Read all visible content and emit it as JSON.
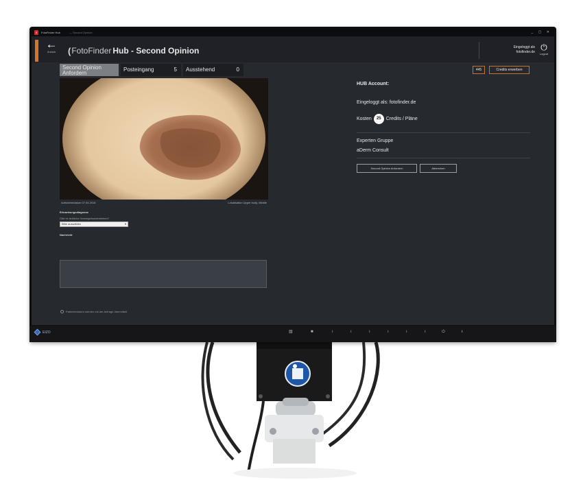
{
  "os_bar": {
    "app_title": "FotoFinder Hub",
    "subtitle": "— Second Opinion",
    "window_controls": "_ ▢ ✕"
  },
  "header": {
    "back_label": "Zurück",
    "logo_text": "FotoFinder",
    "title": "Hub - Second Opinion",
    "user_line1": "Eingeloggt als",
    "user_line2": "fotofinder.de",
    "logout_label": "Logout"
  },
  "tabs": [
    {
      "label": "Second Opinion Anfordern",
      "count": ""
    },
    {
      "label": "Posteingang",
      "count": "5"
    },
    {
      "label": "Ausstehend",
      "count": "0"
    }
  ],
  "credits": {
    "balance": "445",
    "buy_label": "Credits erwerben"
  },
  "image_panel": {
    "caption_left": "Aufnahmedatum     07.04.2016",
    "caption_right": "Lokalisation     Upper body, Middle"
  },
  "form": {
    "diagnosis_label": "Erkrankungsdiagnose",
    "question_label": "Gibt es ärztliche Voreingebundenheiten?",
    "select_value": "Bitte auswählen",
    "notes_label": "Nachricht"
  },
  "checkbox": {
    "label": "Patientendaten werden mit der Anfrage übermittelt"
  },
  "account": {
    "title": "HUB Account:",
    "logged_in": "Eingeloggt als:  fotofinder.de",
    "cost_prefix": "Kosten",
    "cost_value": "25",
    "cost_suffix": "Credits / Pläne",
    "expert_label": "Experten Gruppe",
    "expert_value": "aDerm Consult",
    "request_button": "Second Opinion Anfordern",
    "cancel_button": "Abbrechen"
  },
  "bezel": {
    "brand": "EIZO"
  },
  "colors": {
    "accent_orange": "#d67526",
    "screen_bg": "#26292e",
    "header_bg": "#1f2126"
  }
}
